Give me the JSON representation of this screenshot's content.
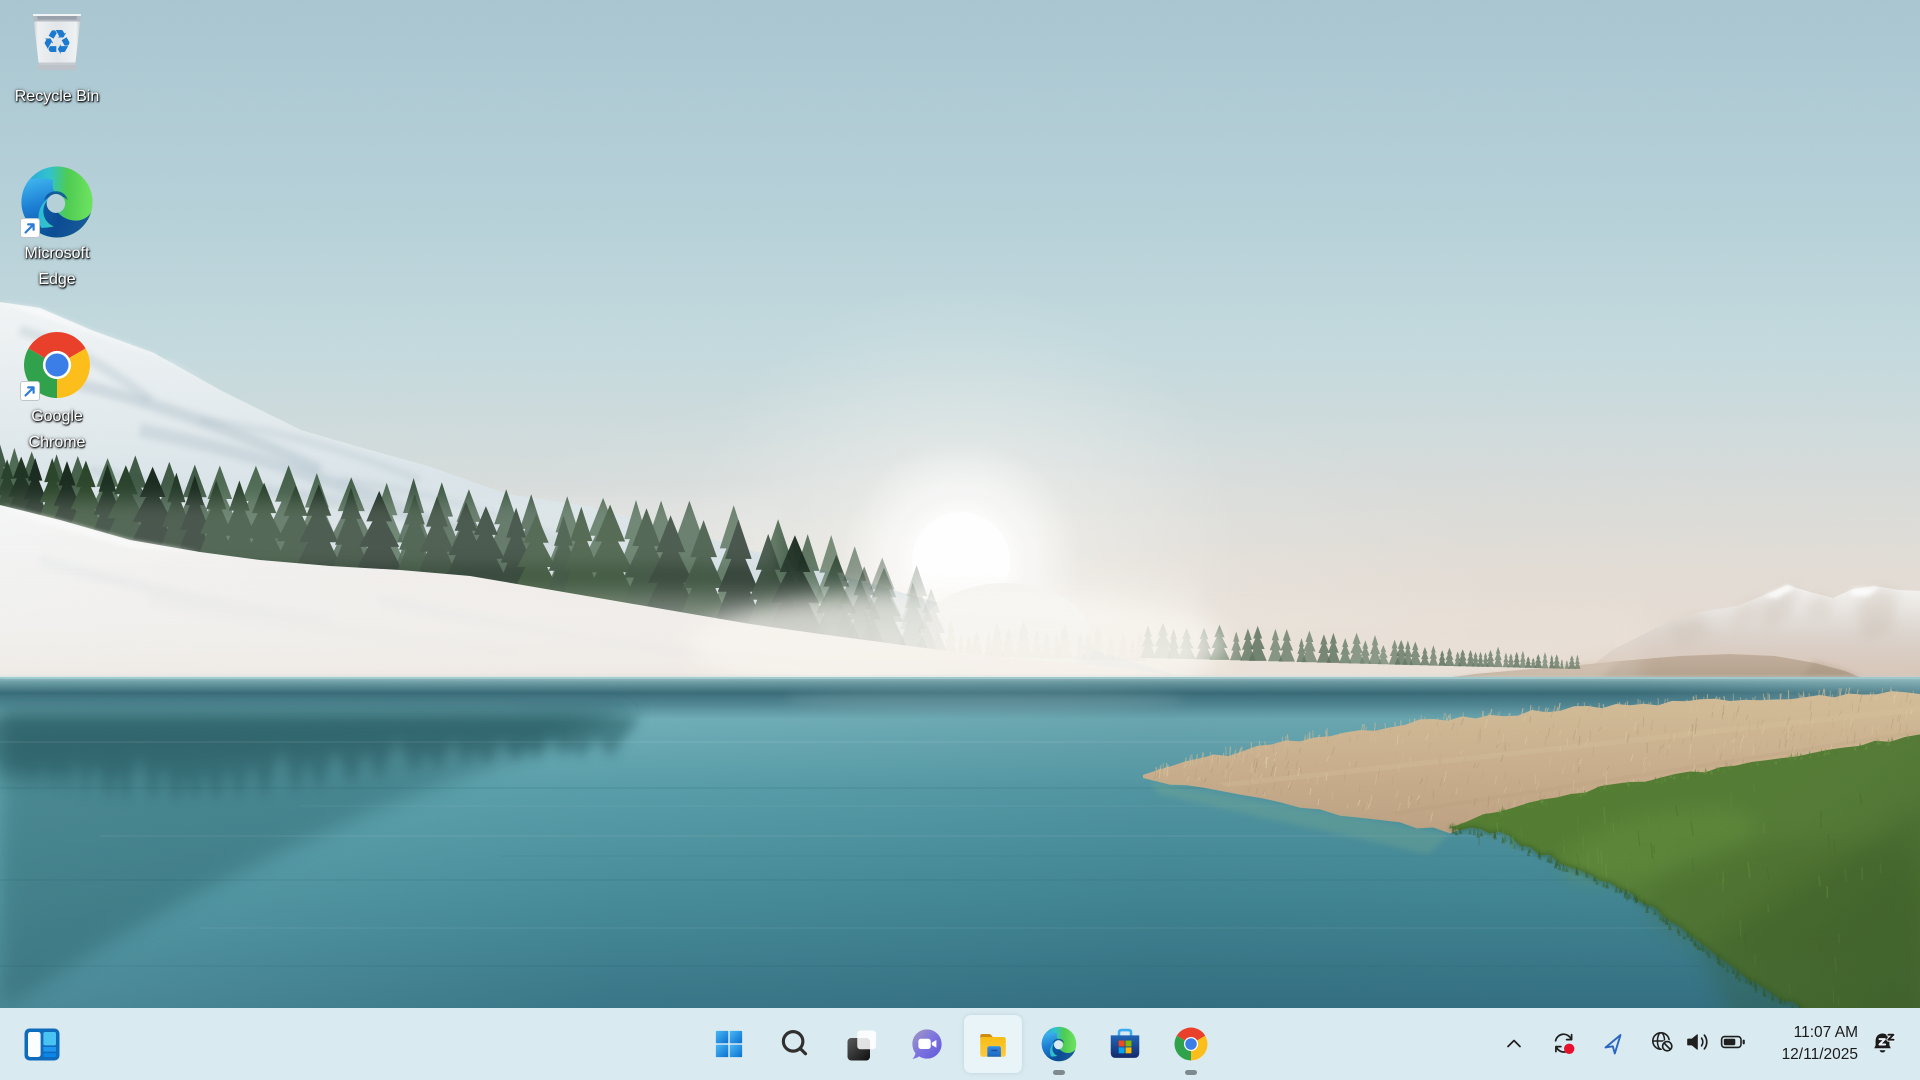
{
  "desktop": {
    "icons": [
      {
        "id": "recycle-bin",
        "label": "Recycle Bin"
      },
      {
        "id": "microsoft-edge",
        "label": "Microsoft Edge"
      },
      {
        "id": "google-chrome",
        "label": "Google Chrome"
      }
    ]
  },
  "taskbar": {
    "widgets": {
      "label": "Widgets"
    },
    "items": [
      {
        "id": "start",
        "label": "Start"
      },
      {
        "id": "search",
        "label": "Search"
      },
      {
        "id": "task-view",
        "label": "Task View"
      },
      {
        "id": "chat",
        "label": "Chat"
      },
      {
        "id": "file-explorer",
        "label": "File Explorer",
        "state": "active"
      },
      {
        "id": "edge",
        "label": "Microsoft Edge",
        "state": "running"
      },
      {
        "id": "store",
        "label": "Microsoft Store",
        "state": ""
      },
      {
        "id": "chrome",
        "label": "Google Chrome",
        "state": "running"
      }
    ],
    "tray": {
      "hidden_icons_label": "Show hidden icons",
      "sync_label": "Sync pending",
      "sync_badge_color": "#e8112d",
      "location_label": "Location in use",
      "network_label": "No internet access",
      "volume_label": "Volume",
      "battery_label": "Battery",
      "clock": {
        "time": "11:07 AM",
        "date": "12/11/2025"
      },
      "notifications_label": "Do not disturb"
    }
  },
  "theme": {
    "taskbar_bg": "#d9eaf0",
    "active_button_bg": "#e9f4f8",
    "running_pill_color": "#7f8a8f",
    "label_color": "#ffffff"
  },
  "wallpaper": {
    "scene": "Morning sun over a calm lake with snowy hills, a pine treeline, distant snowy mountains, a sandy dune and a grassy shore",
    "colors": {
      "sky_top": "#a9c6d1",
      "sky_horizon": "#eae2da",
      "sun": "#ffffff",
      "water_near_horizon": "#9dc8cd",
      "water_deep": "#2e6e7f",
      "snow": "#f0f0ef",
      "pine_trees": "#24382a",
      "dry_grass": "#c2a985",
      "green_grass": "#547a36",
      "right_mountains": "#e9e4dd",
      "sand_dune": "#c2ae9b"
    }
  }
}
